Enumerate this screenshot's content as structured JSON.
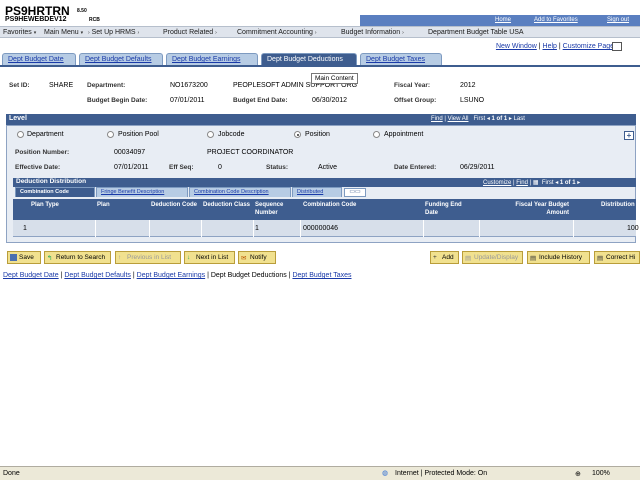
{
  "header": {
    "title": "PS9HRTRN",
    "version": "8.50",
    "subtitle": "PS9HEWEBDEV12",
    "server_tag": "RCB",
    "links": [
      "Home",
      "Add to Favorites",
      "Sign out"
    ]
  },
  "menu": [
    "Favorites",
    "Main Menu",
    "Set Up HRMS",
    "Product Related",
    "Commitment Accounting",
    "Budget Information",
    "Department Budget Table USA"
  ],
  "tabs": [
    "Dept Budget Date",
    "Dept Budget Defaults",
    "Dept Budget Earnings",
    "Dept Budget Deductions",
    "Dept Budget Taxes"
  ],
  "top_links": [
    "New Window",
    "Help",
    "Customize Page"
  ],
  "tooltip": "Main Content",
  "summary": {
    "setid_label": "Set ID:",
    "setid": "SHARE",
    "department_label": "Department:",
    "department": "NO1673200",
    "department_desc": "PEOPLESOFT ADMIN SUPPORT ORG",
    "fiscal_year_label": "Fiscal Year:",
    "fiscal_year": "2012",
    "begin_label": "Budget Begin Date:",
    "begin": "07/01/2011",
    "end_label": "Budget End Date:",
    "end": "06/30/2012",
    "offset_label": "Offset Group:",
    "offset": "LSUNO"
  },
  "level": {
    "title": "Level",
    "nav": {
      "find": "Find",
      "view_all": "View All",
      "first": "First",
      "range": "1 of 1",
      "last": "Last"
    },
    "options": [
      "Department",
      "Position Pool",
      "Jobcode",
      "Position",
      "Appointment"
    ],
    "selected": "Position",
    "position_number_label": "Position Number:",
    "position_number": "00034097",
    "position_desc": "PROJECT COORDINATOR",
    "effective_date_label": "Effective Date:",
    "effective_date": "07/01/2011",
    "eff_seq_label": "Eff Seq:",
    "eff_seq": "0",
    "status_label": "Status:",
    "status": "Active",
    "date_entered_label": "Date Entered:",
    "date_entered": "06/29/2011"
  },
  "dist": {
    "title": "Deduction Distribution",
    "nav": {
      "customize": "Customize",
      "find": "Find",
      "first": "First",
      "range": "1 of 1",
      "last": "Last"
    },
    "subtabs": [
      "Combination Code",
      "Fringe Benefit Description",
      "Combination Code Description",
      "Distributed"
    ],
    "columns": [
      "Plan Type",
      "Plan",
      "Deduction Code",
      "Deduction Class",
      "Sequence Number",
      "Combination Code",
      "Funding End Date",
      "Fiscal Year Budget Amount",
      "Distribution"
    ],
    "row": {
      "num": "1",
      "sequence": "1",
      "combo": "000000046",
      "distribution": "100"
    }
  },
  "buttons": {
    "save": "Save",
    "return": "Return to Search",
    "prev": "Previous in List",
    "next": "Next in List",
    "notify": "Notify",
    "add": "Add",
    "update": "Update/Display",
    "history": "Include History",
    "correct": "Correct Hi"
  },
  "bottom_links": [
    "Dept Budget Date",
    "Dept Budget Defaults",
    "Dept Budget Earnings",
    "Dept Budget Deductions",
    "Dept Budget Taxes"
  ],
  "statusbar": {
    "left": "Done",
    "zone": "Internet | Protected Mode: On",
    "zoom": "100%"
  }
}
